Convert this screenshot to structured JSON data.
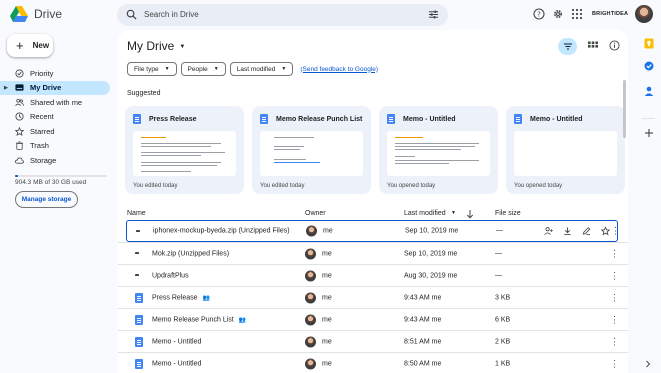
{
  "app": {
    "name": "Drive"
  },
  "search": {
    "placeholder": "Search in Drive"
  },
  "header": {
    "company_logo": "BRIGHTIDEA"
  },
  "sidebar": {
    "new_label": "New",
    "items": [
      {
        "label": "Priority",
        "icon": "priority-icon"
      },
      {
        "label": "My Drive",
        "icon": "my-drive-icon",
        "active": true
      },
      {
        "label": "Shared with me",
        "icon": "shared-with-me-icon"
      },
      {
        "label": "Recent",
        "icon": "clock-icon"
      },
      {
        "label": "Starred",
        "icon": "star-icon"
      },
      {
        "label": "Trash",
        "icon": "trash-icon"
      },
      {
        "label": "Storage",
        "icon": "cloud-icon"
      }
    ],
    "storage_text": "904.3 MB of 30 GB used",
    "storage_fraction": 0.03,
    "manage_storage_label": "Manage storage"
  },
  "main": {
    "title": "My Drive",
    "filters": [
      "File type",
      "People",
      "Last modified"
    ],
    "feedback_link": "(Send feedback to Google)",
    "suggested_label": "Suggested",
    "cards": [
      {
        "title": "Press Release",
        "footer": "You edited today"
      },
      {
        "title": "Memo Release Punch List",
        "footer": "You edited today"
      },
      {
        "title": "Memo - Untitled",
        "footer": "You opened today"
      },
      {
        "title": "Memo - Untitled",
        "footer": "You opened today"
      }
    ],
    "columns": {
      "name": "Name",
      "owner": "Owner",
      "modified": "Last modified",
      "size": "File size"
    },
    "rows": [
      {
        "name": "iphonex-mockup-byeda.zip (Unzipped Files)",
        "type": "folder",
        "owner": "me",
        "modified": "Sep 10, 2019 me",
        "size": "—",
        "selected": true
      },
      {
        "name": "Mok.zip (Unzipped Files)",
        "type": "folder",
        "owner": "me",
        "modified": "Sep 10, 2019 me",
        "size": "—"
      },
      {
        "name": "UpdraftPlus",
        "type": "folder",
        "owner": "me",
        "modified": "Aug 30, 2019 me",
        "size": "—"
      },
      {
        "name": "Press Release",
        "type": "doc",
        "shared": true,
        "owner": "me",
        "modified": "9:43 AM me",
        "size": "3 KB"
      },
      {
        "name": "Memo Release Punch List",
        "type": "doc",
        "shared": true,
        "owner": "me",
        "modified": "9:43 AM me",
        "size": "6 KB"
      },
      {
        "name": "Memo - Untitled",
        "type": "doc",
        "owner": "me",
        "modified": "8:51 AM me",
        "size": "2 KB"
      },
      {
        "name": "Memo - Untitled",
        "type": "doc",
        "owner": "me",
        "modified": "8:50 AM me",
        "size": "1 KB"
      }
    ]
  },
  "colors": {
    "accent": "#0b57d0",
    "active_bg": "#c2e7ff",
    "doc_blue": "#4285f4"
  }
}
